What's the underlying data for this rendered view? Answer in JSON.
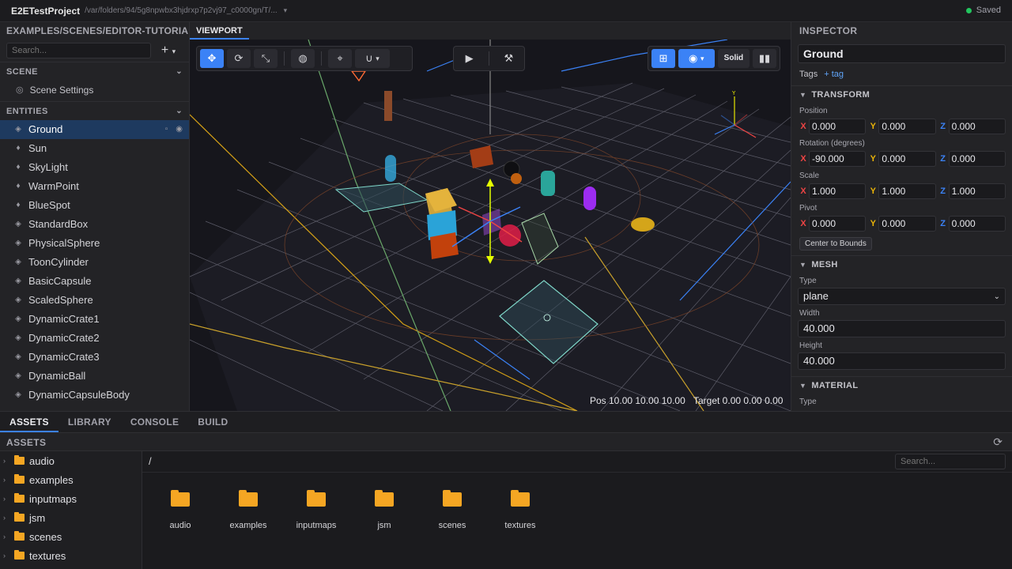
{
  "titlebar": {
    "project": "E2ETestProject",
    "path": "/var/folders/94/5g8npwbx3hjdrxp7p2vj97_c0000gn/T/...",
    "status": "Saved"
  },
  "scene_panel": {
    "file": "EXAMPLES/SCENES/EDITOR-TUTORIAL.VS",
    "search_placeholder": "Search...",
    "add_label": "+",
    "scene_header": "SCENE",
    "scene_settings": "Scene Settings",
    "entities_header": "ENTITIES",
    "entities": [
      {
        "label": "Ground",
        "icon": "mesh-icon"
      },
      {
        "label": "Sun",
        "icon": "light-icon"
      },
      {
        "label": "SkyLight",
        "icon": "light-icon"
      },
      {
        "label": "WarmPoint",
        "icon": "light-icon"
      },
      {
        "label": "BlueSpot",
        "icon": "light-icon"
      },
      {
        "label": "StandardBox",
        "icon": "mesh-icon"
      },
      {
        "label": "PhysicalSphere",
        "icon": "mesh-icon"
      },
      {
        "label": "ToonCylinder",
        "icon": "mesh-icon"
      },
      {
        "label": "BasicCapsule",
        "icon": "mesh-icon"
      },
      {
        "label": "ScaledSphere",
        "icon": "mesh-icon"
      },
      {
        "label": "DynamicCrate1",
        "icon": "mesh-icon"
      },
      {
        "label": "DynamicCrate2",
        "icon": "mesh-icon"
      },
      {
        "label": "DynamicCrate3",
        "icon": "mesh-icon"
      },
      {
        "label": "DynamicBall",
        "icon": "mesh-icon"
      },
      {
        "label": "DynamicCapsuleBody",
        "icon": "mesh-icon"
      }
    ]
  },
  "viewport": {
    "tab": "VIEWPORT",
    "render_mode": "Solid",
    "camera_pos": "Pos 10.00 10.00 10.00",
    "camera_target": "Target 0.00 0.00 0.00",
    "accent": "#3b82f6"
  },
  "inspector": {
    "header": "INSPECTOR",
    "name": "Ground",
    "tags_label": "Tags",
    "add_tag": "+ tag",
    "transform_header": "TRANSFORM",
    "position_label": "Position",
    "position": {
      "x": "0.000",
      "y": "0.000",
      "z": "0.000"
    },
    "rotation_label": "Rotation (degrees)",
    "rotation": {
      "x": "-90.000",
      "y": "0.000",
      "z": "0.000"
    },
    "scale_label": "Scale",
    "scale": {
      "x": "1.000",
      "y": "1.000",
      "z": "1.000"
    },
    "pivot_label": "Pivot",
    "pivot": {
      "x": "0.000",
      "y": "0.000",
      "z": "0.000"
    },
    "center_bounds": "Center to Bounds",
    "mesh_header": "MESH",
    "type_label": "Type",
    "mesh_type": "plane",
    "width_label": "Width",
    "width": "40.000",
    "height_label": "Height",
    "height": "40.000",
    "material_header": "MATERIAL",
    "material_type_label": "Type",
    "axis_x": "X",
    "axis_y": "Y",
    "axis_z": "Z"
  },
  "bottom": {
    "tabs": [
      "ASSETS",
      "LIBRARY",
      "CONSOLE",
      "BUILD"
    ],
    "assets_header": "ASSETS",
    "crumb": "/",
    "search_placeholder": "Search...",
    "tree": [
      "audio",
      "examples",
      "inputmaps",
      "jsm",
      "scenes",
      "textures"
    ],
    "grid": [
      "audio",
      "examples",
      "inputmaps",
      "jsm",
      "scenes",
      "textures"
    ],
    "folder_color": "#f5a623"
  }
}
